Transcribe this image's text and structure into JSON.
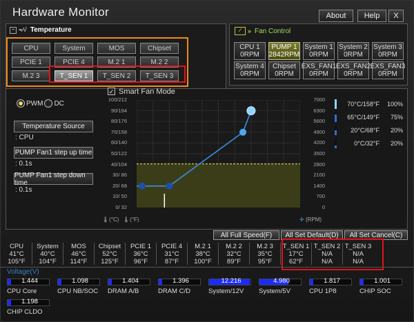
{
  "app_title": "Hardware Monitor",
  "top_buttons": {
    "about": "About",
    "help": "Help",
    "close": "X"
  },
  "temperature": {
    "header": "Temperature",
    "sensors": [
      [
        "CPU",
        "System",
        "MOS",
        "Chipset"
      ],
      [
        "PCIE 1",
        "PCIE 4",
        "M.2 1",
        "M.2 2"
      ],
      [
        "M.2 3",
        "T_SEN 1",
        "T_SEN 2",
        "T_SEN 3"
      ]
    ],
    "selected": "T_SEN 1"
  },
  "fan_control": {
    "header": "Fan Control",
    "fans": [
      {
        "name": "CPU 1",
        "rpm": "0RPM"
      },
      {
        "name": "PUMP 1",
        "rpm": "2842RPM"
      },
      {
        "name": "System 1",
        "rpm": "0RPM"
      },
      {
        "name": "System 2",
        "rpm": "0RPM"
      },
      {
        "name": "System 3",
        "rpm": "0RPM"
      },
      {
        "name": "System 4",
        "rpm": "0RPM"
      },
      {
        "name": "Chipset",
        "rpm": "0RPM"
      },
      {
        "name": "EXS_FAN1",
        "rpm": "0RPM"
      },
      {
        "name": "EXS_FAN2",
        "rpm": "0RPM"
      },
      {
        "name": "EXS_FAN3",
        "rpm": "0RPM"
      }
    ],
    "selected": "PUMP 1"
  },
  "smart_fan": {
    "label": "Smart Fan Mode",
    "mode_pwm": "PWM",
    "mode_dc": "DC",
    "temp_source_label": "Temperature Source",
    "temp_source_value": ": CPU",
    "step_up_label": "PUMP Fan1 step up time",
    "step_up_value": ": 0.1s",
    "step_down_label": "PUMP Fan1 step down time",
    "step_down_value": ": 0.1s",
    "unit_c": "(°C)",
    "unit_f": "(°F)",
    "unit_rpm": "(RPM)"
  },
  "chart_data": {
    "type": "line",
    "y_left_ticks": [
      "100/212",
      "90/194",
      "80/176",
      "70/158",
      "60/140",
      "50/122",
      "40/104",
      "30/ 86",
      "20/ 68",
      "10/ 50",
      "0/ 32"
    ],
    "y_right_ticks": [
      "7000",
      "6300",
      "5600",
      "4900",
      "4200",
      "3500",
      "2800",
      "2100",
      "1400",
      "700",
      "0"
    ],
    "points": [
      {
        "temp_c": 0,
        "rpm": 1400
      },
      {
        "temp_c": 20,
        "rpm": 1400
      },
      {
        "temp_c": 65,
        "rpm": 4900
      },
      {
        "temp_c": 70,
        "rpm": 6300
      }
    ],
    "x_range_c": [
      0,
      100
    ],
    "y_range_rpm": [
      0,
      7000
    ],
    "current_rpm": 2842,
    "current_temp_c": 17,
    "legend": [
      {
        "temp": "70°C/158°F",
        "pct": "100%",
        "level": 1.0
      },
      {
        "temp": "65°C/149°F",
        "pct": "75%",
        "level": 0.75
      },
      {
        "temp": "20°C/68°F",
        "pct": "20%",
        "level": 0.5
      },
      {
        "temp": "0°C/32°F",
        "pct": "20%",
        "level": 0.25
      }
    ]
  },
  "actions": {
    "full_speed": "All Full Speed(F)",
    "set_default": "All Set Default(D)",
    "set_cancel": "All Set Cancel(C)"
  },
  "monitor": [
    {
      "name": "CPU",
      "c": "41°C",
      "f": "105°F"
    },
    {
      "name": "System",
      "c": "40°C",
      "f": "104°F"
    },
    {
      "name": "MOS",
      "c": "46°C",
      "f": "114°F"
    },
    {
      "name": "Chipset",
      "c": "52°C",
      "f": "125°F"
    },
    {
      "name": "PCIE 1",
      "c": "36°C",
      "f": "96°F"
    },
    {
      "name": "PCIE 4",
      "c": "31°C",
      "f": "87°F"
    },
    {
      "name": "M.2 1",
      "c": "38°C",
      "f": "100°F"
    },
    {
      "name": "M.2 2",
      "c": "32°C",
      "f": "89°F"
    },
    {
      "name": "M.2 3",
      "c": "35°C",
      "f": "95°F"
    },
    {
      "name": "T_SEN 1",
      "c": "17°C",
      "f": "62°F"
    },
    {
      "name": "T_SEN 2",
      "c": "N/A",
      "f": "N/A"
    },
    {
      "name": "T_SEN 3",
      "c": "N/A",
      "f": "N/A"
    }
  ],
  "voltage": {
    "header": "Voltage(V)",
    "items": [
      {
        "label": "CPU Core",
        "value": "1.444",
        "level": 0.08
      },
      {
        "label": "CPU NB/SOC",
        "value": "1.098",
        "level": 0.08
      },
      {
        "label": "DRAM A/B",
        "value": "1.404",
        "level": 0.08
      },
      {
        "label": "DRAM C/D",
        "value": "1.396",
        "level": 0.08
      },
      {
        "label": "System/12V",
        "value": "12.216",
        "level": 0.98
      },
      {
        "label": "System/5V",
        "value": "4.980",
        "level": 0.7
      },
      {
        "label": "CPU 1P8",
        "value": "1.817",
        "level": 0.08
      },
      {
        "label": "CHIP SOC",
        "value": "1.001",
        "level": 0.08
      },
      {
        "label": "CHIP CLDO",
        "value": "1.198",
        "level": 0.08
      }
    ]
  },
  "colors": {
    "accent": "#4aa8f0",
    "highlight_orange": "#f08a1c",
    "highlight_red": "#e0141b",
    "voltage_bar": "#1a2bff"
  }
}
